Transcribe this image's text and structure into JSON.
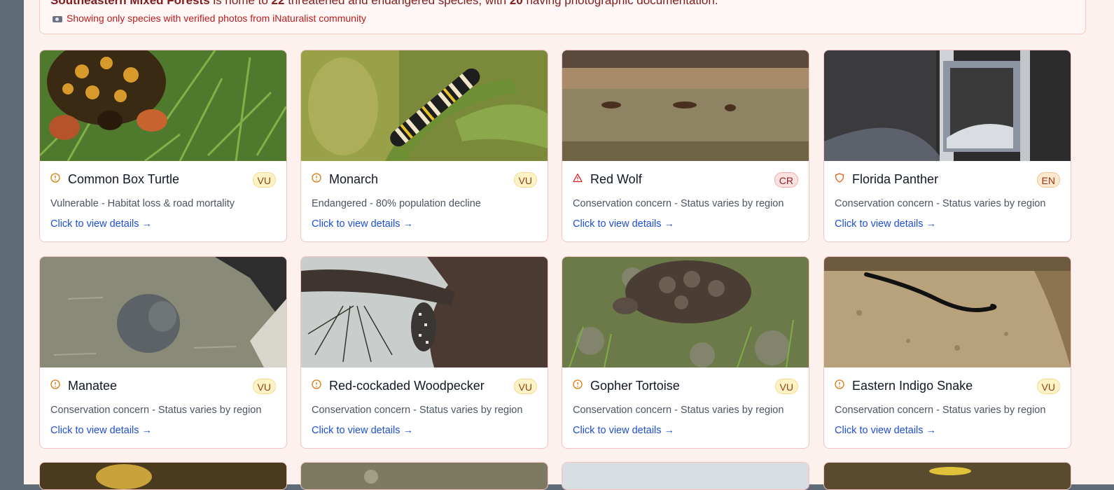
{
  "summary": {
    "region": "Southeastern Mixed Forests",
    "text_is_home_to": " is home to ",
    "threatened_count": "22",
    "text_middle": " threatened and endangered species, with ",
    "photo_count": "20",
    "text_end": " having photographic documentation.",
    "note": "Showing only species with verified photos from iNaturalist community",
    "note_icon": "camera-icon"
  },
  "link_label": "Click to view details →",
  "colors": {
    "vu": "#fef3c7",
    "en": "#fde8d0",
    "cr": "#fde2e2",
    "link": "#1d4ed8",
    "panel": "#fdf1ee"
  },
  "species": [
    {
      "name": "Common Box Turtle",
      "badge": "VU",
      "icon": "info-circle-icon",
      "description": "Vulnerable - Habitat loss & road mortality"
    },
    {
      "name": "Monarch",
      "badge": "VU",
      "icon": "info-circle-icon",
      "description": "Endangered - 80% population decline"
    },
    {
      "name": "Red Wolf",
      "badge": "CR",
      "icon": "warning-triangle-icon",
      "description": "Conservation concern - Status varies by region"
    },
    {
      "name": "Florida Panther",
      "badge": "EN",
      "icon": "shield-icon",
      "description": "Conservation concern - Status varies by region"
    },
    {
      "name": "Manatee",
      "badge": "VU",
      "icon": "info-circle-icon",
      "description": "Conservation concern - Status varies by region"
    },
    {
      "name": "Red-cockaded Woodpecker",
      "badge": "VU",
      "icon": "info-circle-icon",
      "description": "Conservation concern - Status varies by region"
    },
    {
      "name": "Gopher Tortoise",
      "badge": "VU",
      "icon": "info-circle-icon",
      "description": "Conservation concern - Status varies by region"
    },
    {
      "name": "Eastern Indigo Snake",
      "badge": "VU",
      "icon": "info-circle-icon",
      "description": "Conservation concern - Status varies by region"
    }
  ]
}
